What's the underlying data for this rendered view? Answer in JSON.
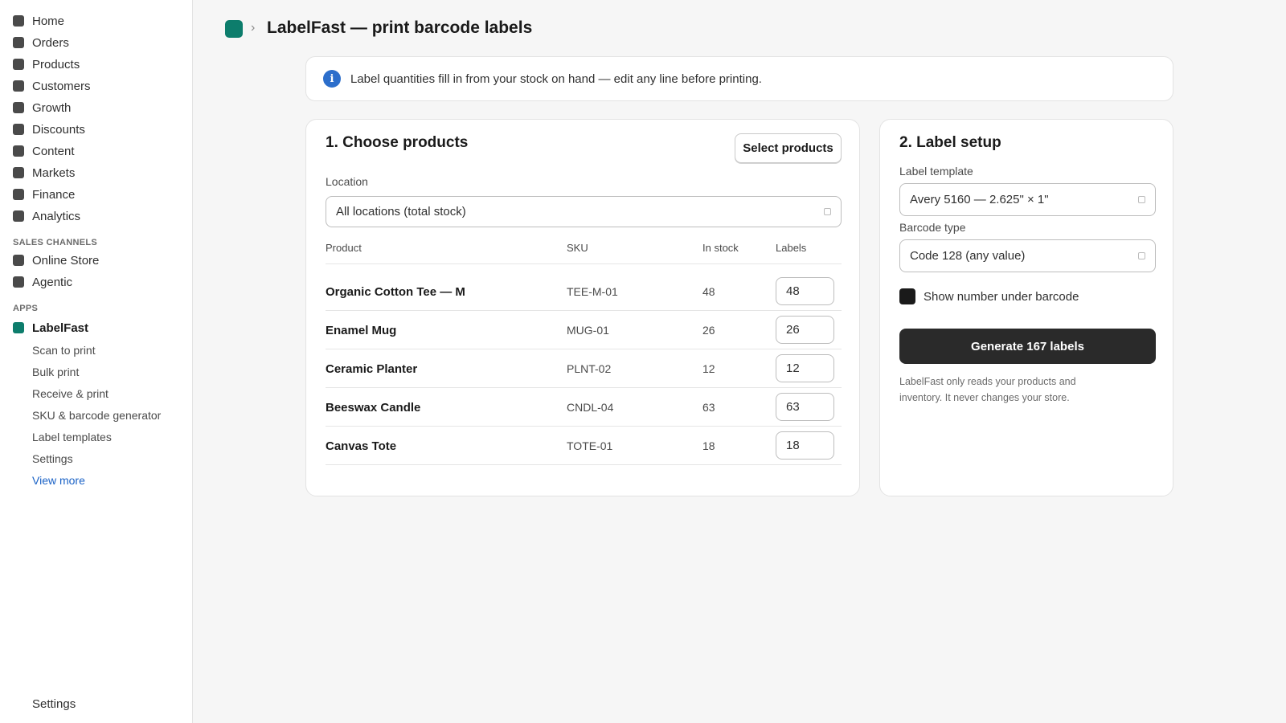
{
  "sidebar": {
    "main_items": [
      {
        "label": "Home",
        "icon": "home-icon"
      },
      {
        "label": "Orders",
        "icon": "orders-icon"
      },
      {
        "label": "Products",
        "icon": "products-icon"
      },
      {
        "label": "Customers",
        "icon": "customers-icon"
      },
      {
        "label": "Growth",
        "icon": "growth-icon"
      },
      {
        "label": "Discounts",
        "icon": "discounts-icon"
      },
      {
        "label": "Content",
        "icon": "content-icon"
      },
      {
        "label": "Markets",
        "icon": "markets-icon"
      },
      {
        "label": "Finance",
        "icon": "finance-icon"
      },
      {
        "label": "Analytics",
        "icon": "analytics-icon"
      }
    ],
    "sales_channels_heading": "SALES CHANNELS",
    "sales_channels": [
      {
        "label": "Online Store",
        "icon": "online-store-icon"
      },
      {
        "label": "Agentic",
        "icon": "agentic-icon"
      }
    ],
    "apps_heading": "APPS",
    "app": {
      "label": "LabelFast",
      "icon": "labelfast-app-icon",
      "color": "#0d7d6c"
    },
    "app_subitems": [
      "Scan to print",
      "Bulk print",
      "Receive & print",
      "SKU & barcode generator",
      "Label templates",
      "Settings"
    ],
    "view_more": "View more",
    "settings": "Settings"
  },
  "header": {
    "title": "LabelFast — print barcode labels",
    "separator": "›"
  },
  "banner": {
    "icon": "info-icon",
    "icon_glyph": "i",
    "text": "Label quantities fill in from your stock on hand — edit any line before printing."
  },
  "products_card": {
    "title": "1. Choose products",
    "select_button": "Select products",
    "location_label": "Location",
    "location_value": "All locations (total stock)",
    "columns": {
      "product": "Product",
      "sku": "SKU",
      "in_stock": "In stock",
      "labels": "Labels"
    },
    "rows": [
      {
        "name": "Organic Cotton Tee — M",
        "sku": "TEE-M-01",
        "in_stock": "48",
        "labels": "48"
      },
      {
        "name": "Enamel Mug",
        "sku": "MUG-01",
        "in_stock": "26",
        "labels": "26"
      },
      {
        "name": "Ceramic Planter",
        "sku": "PLNT-02",
        "in_stock": "12",
        "labels": "12"
      },
      {
        "name": "Beeswax Candle",
        "sku": "CNDL-04",
        "in_stock": "63",
        "labels": "63"
      },
      {
        "name": "Canvas Tote",
        "sku": "TOTE-01",
        "in_stock": "18",
        "labels": "18"
      }
    ]
  },
  "setup_card": {
    "title": "2. Label setup",
    "template_label": "Label template",
    "template_value": "Avery 5160 — 2.625\" × 1\"",
    "barcode_label": "Barcode type",
    "barcode_value": "Code 128 (any value)",
    "show_number_label": "Show number under barcode",
    "show_number_checked": true,
    "generate_button": "Generate 167 labels",
    "footnote": "LabelFast only reads your products and inventory. It never changes your store."
  },
  "colors": {
    "accent": "#0d7d6c",
    "info": "#2c6ecb",
    "primary_button": "#2a2a2a",
    "link": "#1a62c6"
  }
}
